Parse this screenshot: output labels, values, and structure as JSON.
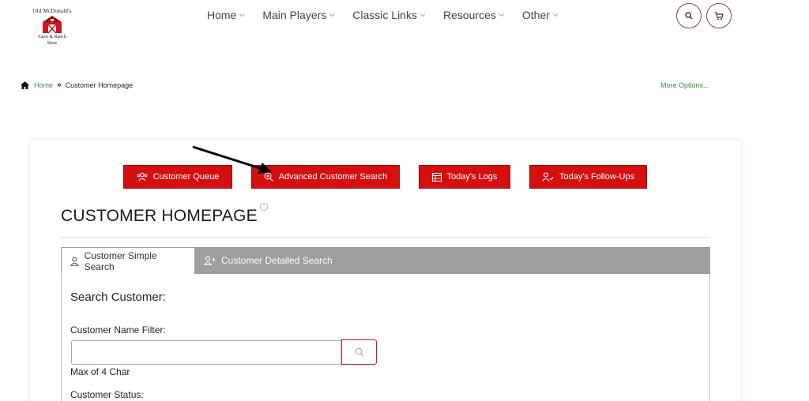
{
  "logo": {
    "line1": "Old McDonald's",
    "line2": "Farm & Ranch",
    "line3": "Store"
  },
  "nav": {
    "items": [
      {
        "label": "Home"
      },
      {
        "label": "Main Players"
      },
      {
        "label": "Classic Links"
      },
      {
        "label": "Resources"
      },
      {
        "label": "Other"
      }
    ],
    "search_icon": "search-icon",
    "cart_icon": "cart-icon"
  },
  "breadcrumb": {
    "home": "Home",
    "current": "Customer Homepage",
    "more": "More Options..."
  },
  "actions": {
    "queue": "Customer Queue",
    "advanced": "Advanced Customer Search",
    "logs": "Today's Logs",
    "followups": "Today's Follow-Ups"
  },
  "page": {
    "title": "CUSTOMER HOMEPAGE",
    "info": "i"
  },
  "tabs": {
    "simple": "Customer Simple Search",
    "detailed": "Customer Detailed Search"
  },
  "search": {
    "heading": "Search Customer:",
    "name_label": "Customer Name Filter:",
    "name_value": "",
    "hint": "Max of 4 Char",
    "status_label": "Customer Status:"
  },
  "colors": {
    "accent_red": "#d40f0f",
    "link_green": "#3f8a3a",
    "tab_gray": "#9e9e9e"
  }
}
